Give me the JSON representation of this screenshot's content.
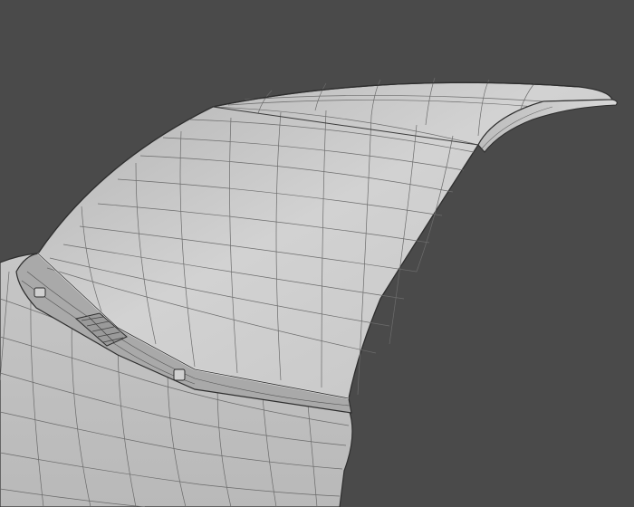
{
  "viewport": {
    "background": "#4a4a4a",
    "shading": "flat-gray-with-wireframe",
    "colors": {
      "surface_light": "#c9c9c9",
      "surface_mid": "#b8b8b8",
      "surface_dark": "#a3a3a3",
      "wire": "#5e5e5e",
      "edge": "#2e2e2e"
    },
    "objects": [
      "rear-spoiler-panel",
      "spoiler-rear-lip",
      "spoiler-mount-base",
      "car-trunk-body",
      "mount-bolt-left",
      "mount-bolt-right",
      "center-vent-grille"
    ]
  }
}
